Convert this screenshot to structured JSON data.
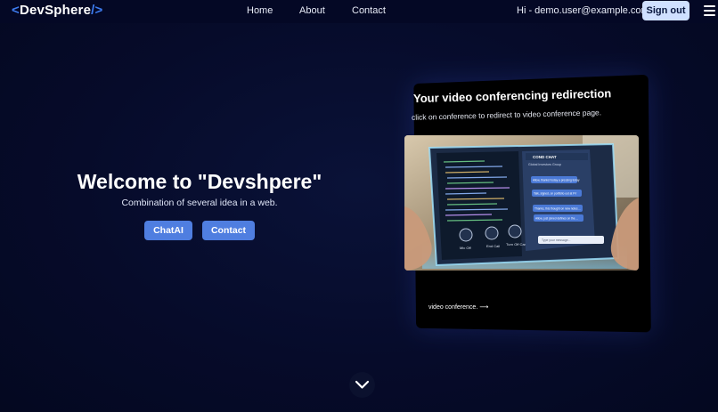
{
  "navbar": {
    "logo_open": "<",
    "logo_text": "DevSphere",
    "logo_close": "/>",
    "links": [
      {
        "label": "Home"
      },
      {
        "label": "About"
      },
      {
        "label": "Contact"
      }
    ],
    "greeting": "Hi - demo.user@example.com",
    "signout_label": "Sign out",
    "menu_icon": "hamburger-menu-icon"
  },
  "hero": {
    "title": "Welcome to \"Devshpere\"",
    "subtitle": "Combination of several idea in a web.",
    "buttons": [
      {
        "label": "ChatAI"
      },
      {
        "label": "Contact"
      }
    ]
  },
  "card": {
    "title": "Your video conferencing redirection",
    "description": "click on conference to redirect to video conference page.",
    "image": {
      "chat_header": "COND CHAT",
      "chat_group": "Global Investors Group",
      "messages": [
        "Allow, thanks! today a pressing today",
        "Talk, signed, on portfolio out at FV",
        "Thanks, this thought on new notes ...",
        "Allow, just joined defines on the ..."
      ],
      "input_placeholder": "Type your message...",
      "controls": [
        "Mic Off",
        "End Call",
        "Turn Off Camera"
      ]
    },
    "link_label": "video conference. ⟶"
  },
  "scroll_icon": "chevron-down-icon",
  "colors": {
    "background": "#050a26",
    "accent": "#3d7cf0",
    "button": "#4f7ee0",
    "signout_bg": "#cfe0ff"
  }
}
